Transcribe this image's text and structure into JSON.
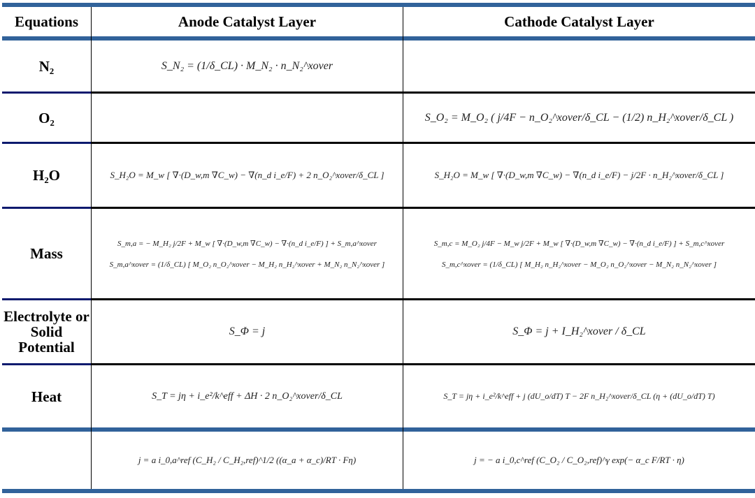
{
  "table": {
    "headers": [
      "Equations",
      "Anode  Catalyst  Layer",
      "Cathode  Catalyst  Layer"
    ],
    "rows": [
      {
        "label": "N₂",
        "anode": "S_N₂ = (1/δ_CL) · M_N₂ · n_N₂^xover",
        "cathode": ""
      },
      {
        "label": "O₂",
        "anode": "",
        "cathode": "S_O₂ = M_O₂ ( j/4F − n_O₂^xover/δ_CL − (1/2) n_H₂^xover/δ_CL )"
      },
      {
        "label": "H₂O",
        "anode": "S_H₂O = M_w [ ∇·(D_w,m ∇C_w) − ∇(n_d i_e/F) + 2 n_O₂^xover/δ_CL ]",
        "cathode": "S_H₂O = M_w [ ∇·(D_w,m ∇C_w) − ∇(n_d i_e/F) − j/2F · n_H₂^xover/δ_CL ]"
      },
      {
        "label": "Mass",
        "anode": "S_m,a = − M_H₂ j/2F + M_w [ ∇·(D_w,m ∇C_w) − ∇·(n_d i_e/F) ] + S_m,a^xover",
        "anode2": "S_m,a^xover = (1/δ_CL) [ M_O₂ n_O₂^xover − M_H₂ n_H₂^xover + M_N₂ n_N₂^xover ]",
        "cathode": "S_m,c = M_O₂ j/4F − M_w j/2F + M_w [ ∇·(D_w,m ∇C_w) − ∇·(n_d i_e/F) ] + S_m,c^xover",
        "cathode2": "S_m,c^xover = (1/δ_CL) [ M_H₂ n_H₂^xover − M_O₂ n_O₂^xover − M_N₂ n_N₂^xover ]"
      },
      {
        "label": "Electrolyte or  Solid Potential",
        "anode": "S_Φ = j",
        "cathode": "S_Φ = j + I_H₂^xover / δ_CL"
      },
      {
        "label": "Heat",
        "anode": "S_T = jη + i_e²/k^eff + ΔH · 2 n_O₂^xover/δ_CL",
        "cathode": "S_T = jη + i_e²/k^eff + j (dU_o/dT) T − 2F n_H₂^xover/δ_CL (η + (dU_o/dT) T)"
      },
      {
        "label": "",
        "anode": "j = a i_0,a^ref (C_H₂ / C_H₂,ref)^1/2 ((α_a + α_c)/RT · Fη)",
        "cathode": "j = − a i_0,c^ref (C_O₂ / C_O₂,ref)^γ exp(− α_c F/RT · η)"
      }
    ]
  },
  "colors": {
    "rule_blue": "#31629a",
    "label_rule": "#0d1a6e",
    "body_rule": "#000000"
  }
}
